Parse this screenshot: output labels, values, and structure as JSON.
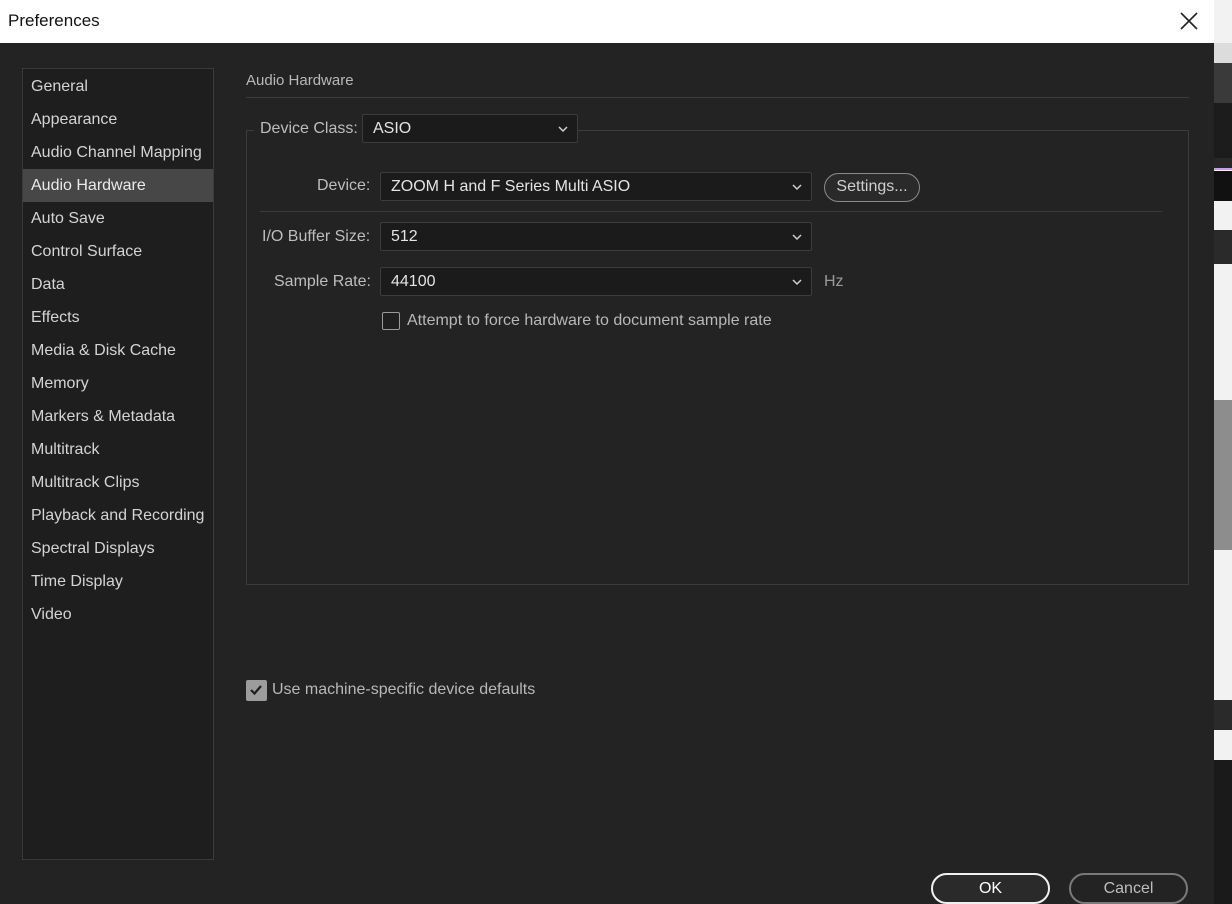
{
  "window": {
    "title": "Preferences",
    "close_icon": "close-icon"
  },
  "sidebar": {
    "items": [
      {
        "label": "General",
        "active": false
      },
      {
        "label": "Appearance",
        "active": false
      },
      {
        "label": "Audio Channel Mapping",
        "active": false
      },
      {
        "label": "Audio Hardware",
        "active": true
      },
      {
        "label": "Auto Save",
        "active": false
      },
      {
        "label": "Control Surface",
        "active": false
      },
      {
        "label": "Data",
        "active": false
      },
      {
        "label": "Effects",
        "active": false
      },
      {
        "label": "Media & Disk Cache",
        "active": false
      },
      {
        "label": "Memory",
        "active": false
      },
      {
        "label": "Markers & Metadata",
        "active": false
      },
      {
        "label": "Multitrack",
        "active": false
      },
      {
        "label": "Multitrack Clips",
        "active": false
      },
      {
        "label": "Playback and Recording",
        "active": false
      },
      {
        "label": "Spectral Displays",
        "active": false
      },
      {
        "label": "Time Display",
        "active": false
      },
      {
        "label": "Video",
        "active": false
      }
    ]
  },
  "panel": {
    "title": "Audio Hardware",
    "device_class": {
      "label": "Device Class:",
      "value": "ASIO"
    },
    "device": {
      "label": "Device:",
      "value": "ZOOM H and F Series Multi ASIO",
      "settings_label": "Settings..."
    },
    "buffer_size": {
      "label": "I/O Buffer Size:",
      "value": "512"
    },
    "sample_rate": {
      "label": "Sample Rate:",
      "value": "44100",
      "unit": "Hz"
    },
    "force_rate": {
      "label": "Attempt to force hardware to document sample rate",
      "checked": false
    },
    "machine_defaults": {
      "label": "Use machine-specific device defaults",
      "checked": true
    }
  },
  "footer": {
    "ok_label": "OK",
    "cancel_label": "Cancel"
  },
  "colors": {
    "background": "#232323",
    "sidebar_active": "#474747",
    "text": "#d0d0d0"
  }
}
